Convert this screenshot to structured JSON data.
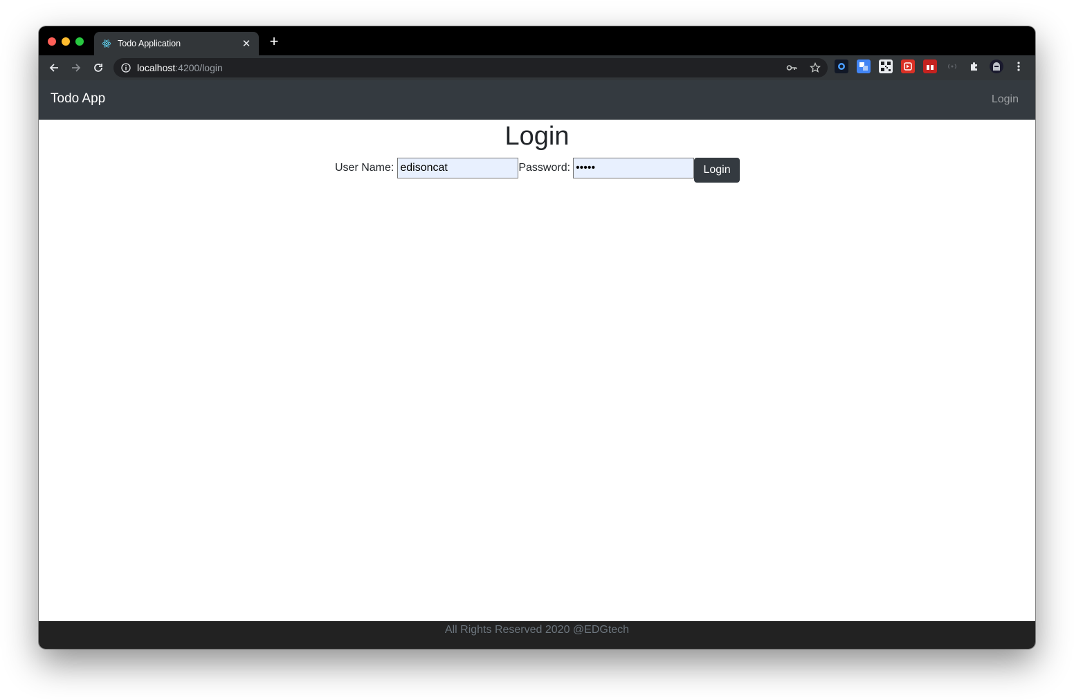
{
  "browser": {
    "tab": {
      "title": "Todo Application",
      "close_glyph": "✕",
      "favicon": "react-icon"
    },
    "new_tab_glyph": "+",
    "url": {
      "host": "localhost",
      "rest": ":4200/login"
    },
    "extensions": [
      "extension-1-icon",
      "translate-extension-icon",
      "qr-extension-icon",
      "red-extension-icon",
      "red-gift-extension-icon",
      "dim-extension-icon",
      "puzzle-icon",
      "profile-avatar-icon"
    ],
    "colors": {
      "titlebar": "#000000",
      "toolbar": "#323639",
      "omnibox": "#202124"
    }
  },
  "navbar": {
    "brand": "Todo App",
    "login_link": "Login",
    "background": "#343a40"
  },
  "main": {
    "heading": "Login",
    "username_label": "User Name:",
    "username_value": "edisoncat",
    "password_label": "Password:",
    "password_value": "•••••",
    "submit_label": "Login"
  },
  "footer": {
    "text": "All Rights Reserved 2020 @EDGtech",
    "background": "#222222"
  }
}
